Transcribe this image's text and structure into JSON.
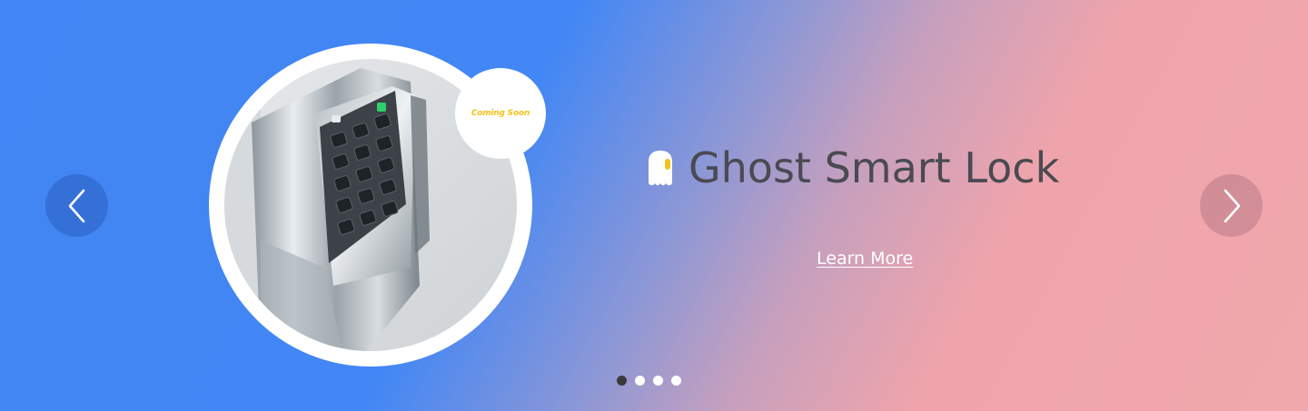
{
  "carousel": {
    "prev_icon": "chevron-left-icon",
    "next_icon": "chevron-right-icon",
    "active_index": 0,
    "slide_count": 4
  },
  "slide": {
    "badge_text": "Coming Soon",
    "brand_icon": "ghost-icon",
    "title": "Ghost Smart Lock",
    "cta_label": "Learn More"
  },
  "colors": {
    "gradient_start": "#4285f4",
    "gradient_end": "#f0a8ac",
    "badge_text": "#f2c21b",
    "title_text": "#4a4a52",
    "dot_active": "#3a3a3a",
    "dot_inactive": "#ffffff"
  }
}
